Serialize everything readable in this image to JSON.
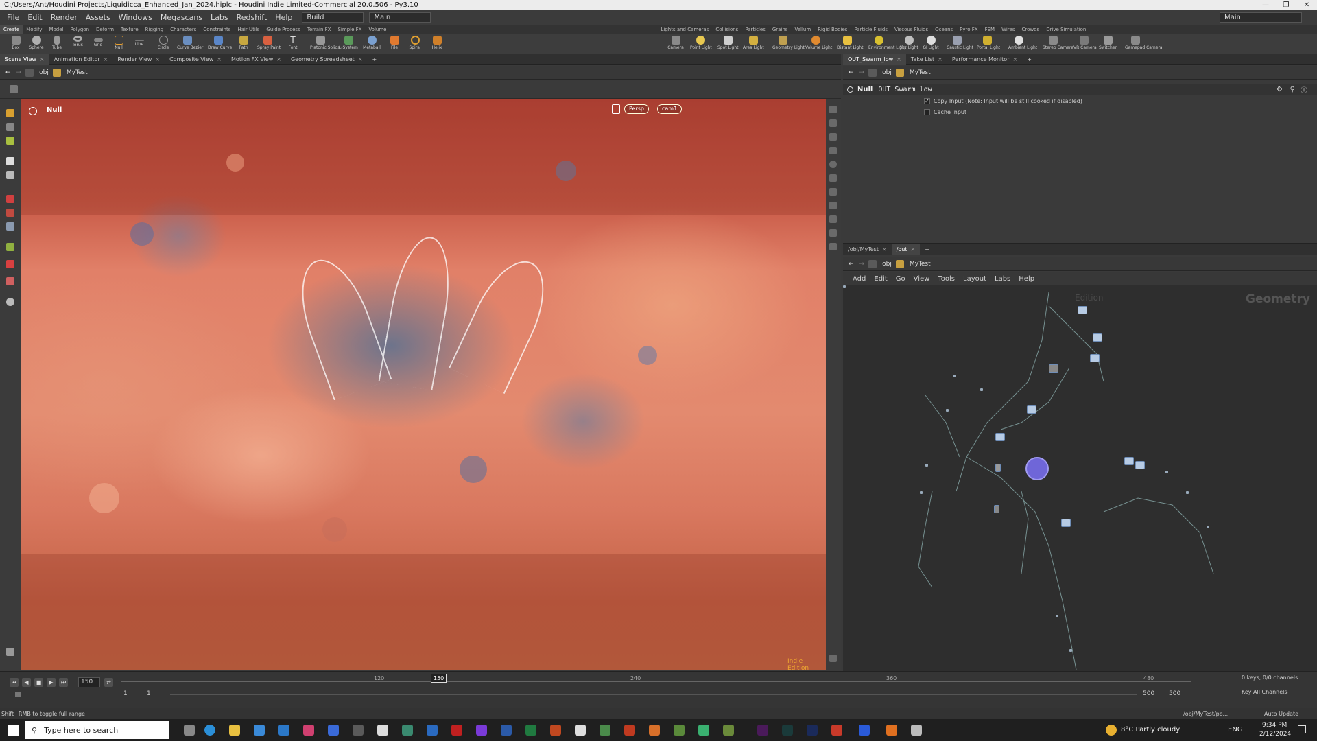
{
  "window": {
    "title": "C:/Users/Ant/Houdini Projects/Liquidicca_Enhanced_Jan_2024.hiplc - Houdini Indie Limited-Commercial 20.0.506 - Py3.10"
  },
  "menu": {
    "items": [
      "File",
      "Edit",
      "Render",
      "Assets",
      "Windows",
      "Megascans",
      "Labs",
      "Redshift",
      "Help"
    ],
    "desktop": "Build",
    "workspace": "Main",
    "right_desktop": "Main"
  },
  "shelf_tabs_left": [
    "Create",
    "Modify",
    "Model",
    "Polygon",
    "Deform",
    "Texture",
    "Rigging",
    "Characters",
    "Constraints",
    "Hair Utils",
    "Guide Process",
    "Terrain FX",
    "Simple FX",
    "Volume"
  ],
  "shelf_tabs_right": [
    "Lights and Cameras",
    "Collisions",
    "Particles",
    "Grains",
    "Vellum",
    "Rigid Bodies",
    "Particle Fluids",
    "Viscous Fluids",
    "Oceans",
    "Pyro FX",
    "FEM",
    "Wires",
    "Crowds",
    "Drive Simulation"
  ],
  "tools_left": [
    "Box",
    "Sphere",
    "Tube",
    "Torus",
    "Grid",
    "Null",
    "Line",
    "Circle",
    "Curve Bezier",
    "Draw Curve",
    "Path",
    "Spray Paint",
    "Font",
    "Platonic Solids",
    "L-System",
    "Metaball",
    "File",
    "Spiral",
    "Helix"
  ],
  "tools_right": [
    "Camera",
    "Point Light",
    "Spot Light",
    "Area Light",
    "Geometry Light",
    "Volume Light",
    "Distant Light",
    "Environment Light",
    "Sky Light",
    "GI Light",
    "Caustic Light",
    "Portal Light",
    "Ambient Light",
    "Stereo Camera",
    "VR Camera",
    "Switcher",
    "Gamepad Camera"
  ],
  "pane_tabs_left": [
    "Scene View",
    "Animation Editor",
    "Render View",
    "Composite View",
    "Motion FX View",
    "Geometry Spreadsheet"
  ],
  "pane_tabs_params": [
    "OUT_Swarm_low",
    "Take List",
    "Performance Monitor"
  ],
  "pane_tabs_network": [
    "/obj/MyTest",
    "/out"
  ],
  "path": {
    "obj": "obj",
    "node": "MyTest"
  },
  "viewport": {
    "node_label": "Null",
    "persp": "Persp",
    "camera": "cam1",
    "watermark": "Indie Edition"
  },
  "params": {
    "type": "Null",
    "name": "OUT_Swarm_low",
    "copy_input": "Copy Input (Note: Input will be still cooked if disabled)",
    "cache_input": "Cache Input"
  },
  "network": {
    "menus": [
      "Add",
      "Edit",
      "Go",
      "View",
      "Tools",
      "Layout",
      "Labs",
      "Help"
    ],
    "context": "Geometry",
    "edition": "Edition"
  },
  "timeline": {
    "frame": "150",
    "start": "1",
    "start2": "1",
    "end": "500",
    "end2": "500",
    "ticks": [
      "120",
      "240",
      "360",
      "480"
    ],
    "marker": "150",
    "keys": "0 keys, 0/0 channels",
    "key_all": "Key All Channels",
    "auto_update": "Auto Update",
    "path": "/obj/MyTest/po..."
  },
  "status": {
    "hint": "Shift+RMB to toggle full range"
  },
  "taskbar": {
    "search": "Type here to search",
    "weather": "8°C  Partly cloudy",
    "lang": "ENG",
    "time": "9:34 PM",
    "date": "2/12/2024"
  },
  "colors": {
    "accent": "#f0a830",
    "viewport_red": "#c85a47",
    "node": "#b7cbe4",
    "selected_node": "#7a6ae0"
  }
}
